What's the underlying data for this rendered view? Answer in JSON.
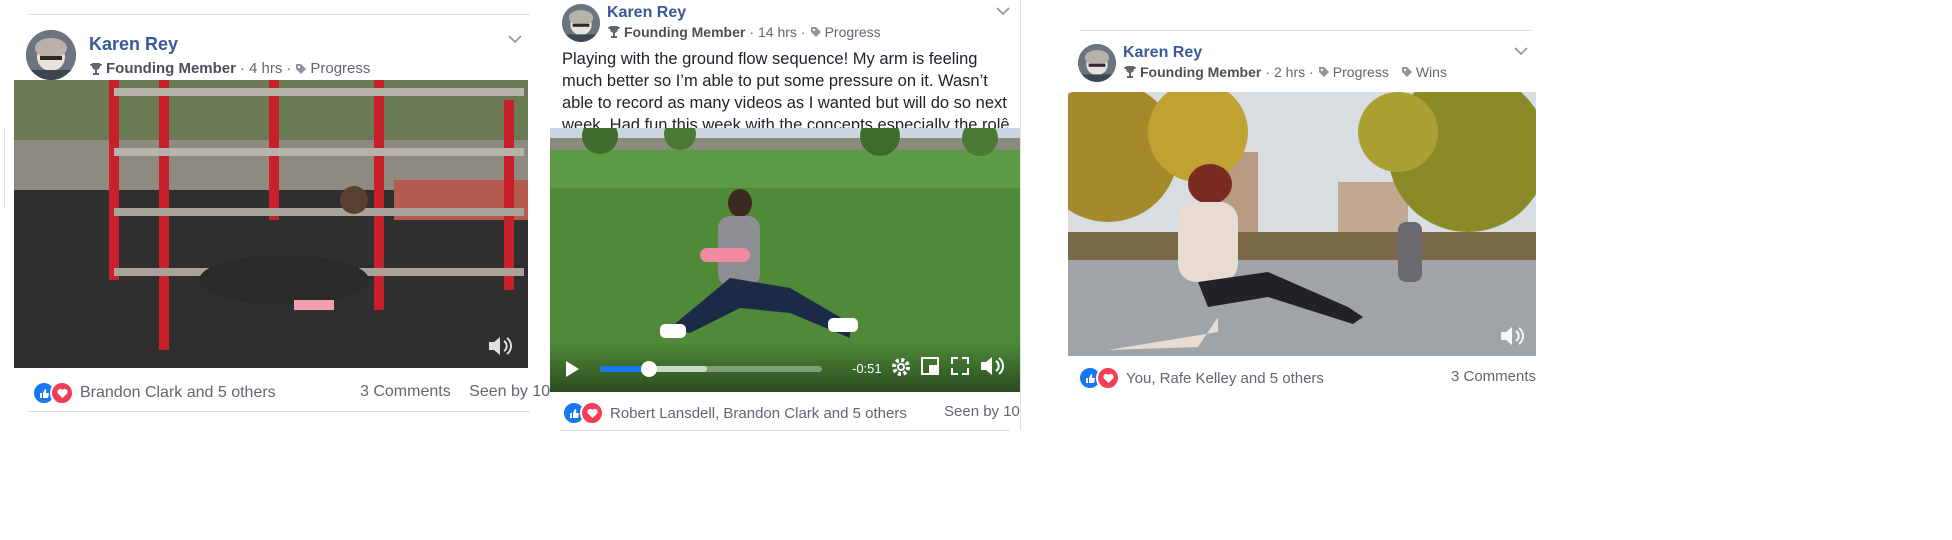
{
  "posts": [
    {
      "author": "Karen Rey",
      "badge": "Founding Member",
      "time": "4 hrs",
      "tags": [
        "Progress"
      ],
      "reactions_text": "Brandon Clark and 5 others",
      "comments": "3 Comments",
      "seen": "Seen by 10"
    },
    {
      "author": "Karen Rey",
      "badge": "Founding Member",
      "time": "14 hrs",
      "tags": [
        "Progress"
      ],
      "body": "Playing with the ground flow sequence! My arm is feeling much better so I’m able to put some pressure on it. Wasn’t able to record as many videos as I wanted but will do so next week. Had fun this week with the concepts especially the rolê and the climbing.",
      "video_time": "-0:51",
      "video_progress": 0.22,
      "video_buffered": 0.48,
      "reactions_text": "Robert Lansdell, Brandon Clark and 5 others",
      "seen": "Seen by 10"
    },
    {
      "author": "Karen Rey",
      "badge": "Founding Member",
      "time": "2 hrs",
      "tags": [
        "Progress",
        "Wins"
      ],
      "reactions_text": "You, Rafe Kelley and 5 others",
      "comments": "3 Comments"
    }
  ],
  "icons": {
    "like": "like-icon",
    "love": "love-icon",
    "tag": "tag-icon",
    "badge": "trophy-icon",
    "menu": "chevron-down-icon",
    "volume": "volume-icon",
    "play": "play-icon",
    "settings": "gear-icon",
    "pip": "picture-in-picture-icon",
    "fullscreen": "fullscreen-icon"
  },
  "colors": {
    "author": "#385898",
    "like": "#1877f2",
    "love": "#f33e58",
    "progress": "#1877f2"
  }
}
